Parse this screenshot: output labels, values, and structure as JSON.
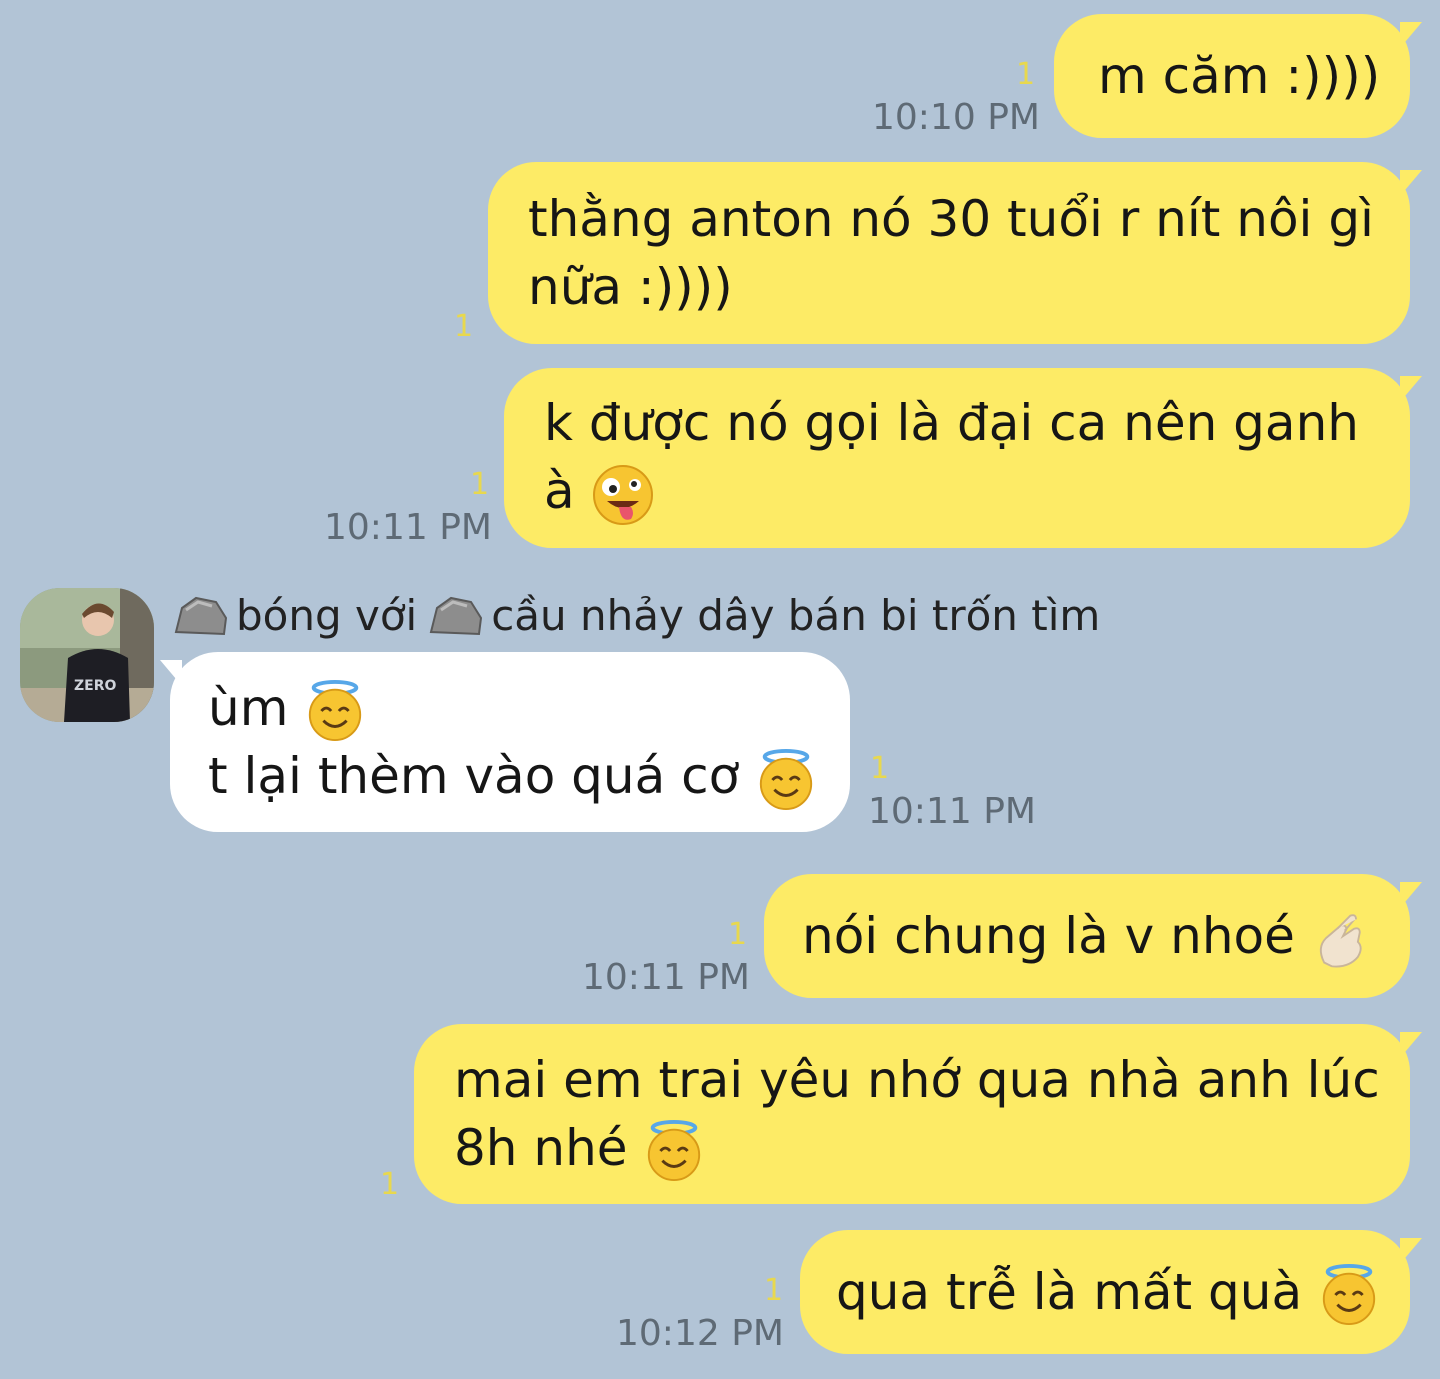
{
  "colors": {
    "background": "#b2c4d6",
    "outgoing_bubble": "#fdeb66",
    "incoming_bubble": "#ffffff",
    "read_counter": "#e8d84e",
    "timestamp": "#5e6a75"
  },
  "messages": [
    {
      "id": "m1",
      "direction": "out",
      "lines": [
        "m căm :))))"
      ],
      "read": "1",
      "time": "10:10 PM"
    },
    {
      "id": "m2",
      "direction": "out",
      "lines": [
        "thằng anton nó 30 tuổi r nít nôi gì",
        "nữa :))))"
      ],
      "read": "1",
      "time": ""
    },
    {
      "id": "m3",
      "direction": "out",
      "lines": [
        "k được nó gọi là đại ca nên ganh",
        "à"
      ],
      "emoji": "zany-face",
      "read": "1",
      "time": "10:11 PM"
    },
    {
      "id": "m4",
      "direction": "in",
      "lines": [
        "ùm",
        "t lại thèm vào quá cơ"
      ],
      "emoji": "smiling-face-with-halo",
      "read": "1",
      "time": "10:11 PM"
    },
    {
      "id": "m5",
      "direction": "out",
      "lines": [
        "nói chung là v nhoé"
      ],
      "emoji": "finger-heart",
      "read": "1",
      "time": "10:11 PM"
    },
    {
      "id": "m6",
      "direction": "out",
      "lines": [
        "mai em trai yêu nhớ qua nhà anh lúc",
        "8h nhé"
      ],
      "emoji": "smiling-face-with-halo",
      "read": "1",
      "time": ""
    },
    {
      "id": "m7",
      "direction": "out",
      "lines": [
        "qua trễ là mất quà"
      ],
      "emoji": "smiling-face-with-halo",
      "read": "1",
      "time": "10:12 PM"
    }
  ],
  "sender": {
    "name_part1": "bóng với",
    "name_part2": "cầu nhảy dây bán bi trốn tìm",
    "icon": "rock-emoji",
    "avatar_shirt_text": "ZERO"
  }
}
